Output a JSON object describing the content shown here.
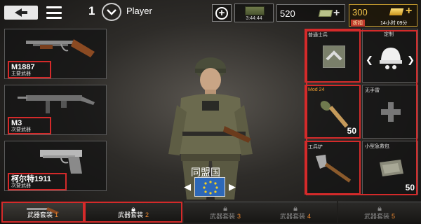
{
  "header": {
    "level": "1",
    "player_name": "Player",
    "supply_timer": "3:44:44",
    "cash": "520",
    "gold": "300",
    "gold_discount": "折扣",
    "gold_time_left": "14小时 09分"
  },
  "weapons": [
    {
      "name": "M1887",
      "type": "主要武器"
    },
    {
      "name": "M3",
      "type": "次要武器"
    },
    {
      "name": "柯尔特1911",
      "type": "次要武器"
    }
  ],
  "equipment": {
    "rank": {
      "label": "普通士兵"
    },
    "custom": {
      "label": "定制"
    },
    "grenade": {
      "label": "Mod 24",
      "count": "50"
    },
    "no_grenade": {
      "label": "无手雷"
    },
    "shovel": {
      "label": "工兵铲"
    },
    "medkit": {
      "label": "小型急救包",
      "count": "50"
    }
  },
  "faction": {
    "name": "同盟国",
    "flag_color": "#2d68b8"
  },
  "loadouts": [
    {
      "label": "武器套装",
      "num": "1",
      "state": "active"
    },
    {
      "label": "武器套装",
      "num": "2",
      "state": "locked"
    },
    {
      "label": "武器套装",
      "num": "3",
      "state": "locked"
    },
    {
      "label": "武器套装",
      "num": "4",
      "state": "locked"
    },
    {
      "label": "武器套装",
      "num": "5",
      "state": "locked"
    }
  ],
  "colors": {
    "accent_red": "#d42a2a",
    "gold": "#f5c64b",
    "orange": "#f0a030"
  }
}
